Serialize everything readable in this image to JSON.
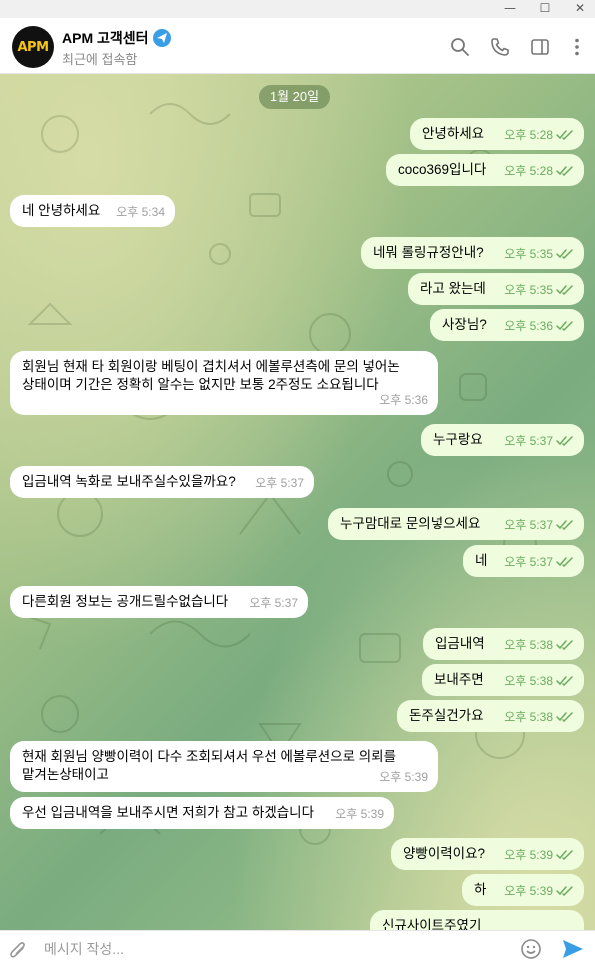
{
  "window": {
    "minimize_glyph": "—",
    "maximize_glyph": "☐",
    "close_glyph": "✕"
  },
  "header": {
    "avatar_text": "APM",
    "title": "APM 고객센터",
    "status": "최근에 접속함",
    "icons": [
      "search-icon",
      "phone-icon",
      "sidebar-icon",
      "more-icon"
    ]
  },
  "colors": {
    "outgoing_bubble": "#effdde",
    "incoming_bubble": "#ffffff",
    "accent": "#3a9ee6",
    "read_check": "#6aab5e"
  },
  "chat": {
    "date": "1월 20일",
    "messages": [
      {
        "dir": "out",
        "text": "안녕하세요",
        "time": "오후 5:28"
      },
      {
        "dir": "out",
        "text": "coco369입니다",
        "time": "오후 5:28"
      },
      {
        "dir": "in",
        "text": "네 안녕하세요",
        "time": "오후 5:34"
      },
      {
        "dir": "out",
        "text": "네뭐 롤링규정안내?",
        "time": "오후 5:35"
      },
      {
        "dir": "out",
        "text": "라고 왔는데",
        "time": "오후 5:35"
      },
      {
        "dir": "out",
        "text": "사장님?",
        "time": "오후 5:36"
      },
      {
        "dir": "in",
        "text": "회원님 현재 타 회원이랑 베팅이 겹치셔서 에볼루션측에 문의 넣어논\n상태이며 기간은 정확히 알수는 없지만 보통 2주정도 소요됩니다",
        "time": "오후 5:36"
      },
      {
        "dir": "out",
        "text": "누구랑요",
        "time": "오후 5:37"
      },
      {
        "dir": "in",
        "text": "입금내역 녹화로 보내주실수있을까요?",
        "time": "오후 5:37"
      },
      {
        "dir": "out",
        "text": "누구맘대로 문의넣으세요",
        "time": "오후 5:37"
      },
      {
        "dir": "out",
        "text": "네",
        "time": "오후 5:37"
      },
      {
        "dir": "in",
        "text": "다른회원 정보는 공개드릴수없습니다",
        "time": "오후 5:37"
      },
      {
        "dir": "out",
        "text": "입금내역",
        "time": "오후 5:38"
      },
      {
        "dir": "out",
        "text": "보내주면",
        "time": "오후 5:38"
      },
      {
        "dir": "out",
        "text": "돈주실건가요",
        "time": "오후 5:38"
      },
      {
        "dir": "in",
        "text": "현재 회원님 양빵이력이 다수 조회되셔서 우선 에볼루션으로 의뢰를\n맡겨논상태이고",
        "time": "오후 5:39"
      },
      {
        "dir": "in",
        "text": "우선 입금내역을 보내주시면 저희가 참고 하겠습니다",
        "time": "오후 5:39"
      },
      {
        "dir": "out",
        "text": "양빵이력이요?",
        "time": "오후 5:39"
      },
      {
        "dir": "out",
        "text": "하",
        "time": "오후 5:39"
      },
      {
        "dir": "out",
        "text": "신규사이트주였기",
        "time": ""
      }
    ]
  },
  "composer": {
    "placeholder": "메시지 작성..."
  }
}
